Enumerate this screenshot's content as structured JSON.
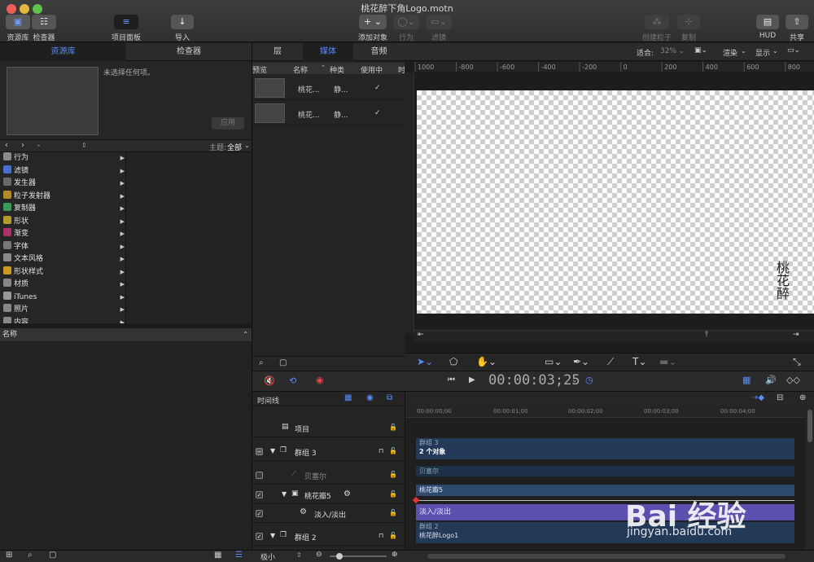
{
  "window": {
    "title": "桃花醉下角Logo.motn"
  },
  "toolbar": {
    "library": "资源库",
    "inspector": "检查器",
    "project_panel": "项目面板",
    "import": "导入",
    "add_object": "添加对象",
    "behaviors": "行为",
    "filters": "滤镜",
    "create_particles": "创建粒子",
    "replicate": "复制",
    "hud": "HUD",
    "share": "共享"
  },
  "left_panel": {
    "tabs": [
      "资源库",
      "检查器"
    ],
    "no_selection": "未选择任何项。",
    "apply": "应用",
    "path_value": "-",
    "theme_label": "主题:",
    "theme_value": "全部",
    "categories": [
      {
        "label": "行为",
        "icon": "gear-icon",
        "color": "#8a8a8a"
      },
      {
        "label": "滤镜",
        "icon": "filter-icon",
        "color": "#4a6fd1"
      },
      {
        "label": "发生器",
        "icon": "generator-icon",
        "color": "#6a6a6a"
      },
      {
        "label": "粒子发射器",
        "icon": "particle-icon",
        "color": "#b58a2a"
      },
      {
        "label": "复制器",
        "icon": "replicator-icon",
        "color": "#3a9a5a"
      },
      {
        "label": "形状",
        "icon": "shape-icon",
        "color": "#b59a2a"
      },
      {
        "label": "渐变",
        "icon": "gradient-icon",
        "color": "#b0306a"
      },
      {
        "label": "字体",
        "icon": "font-icon",
        "color": "#777777"
      },
      {
        "label": "文本风格",
        "icon": "text-style-icon",
        "color": "#8a8a8a"
      },
      {
        "label": "形状样式",
        "icon": "shape-style-icon",
        "color": "#c89a20"
      },
      {
        "label": "材质",
        "icon": "material-icon",
        "color": "#888888"
      },
      {
        "label": "iTunes",
        "icon": "itunes-icon",
        "color": "#999999"
      },
      {
        "label": "照片",
        "icon": "photos-icon",
        "color": "#888888"
      },
      {
        "label": "内容",
        "icon": "content-icon",
        "color": "#888888"
      }
    ],
    "name_header": "名称"
  },
  "middle_panel": {
    "tabs": [
      "层",
      "媒体",
      "音频"
    ],
    "columns": [
      "预览",
      "名称",
      "种类",
      "使用中",
      "时"
    ],
    "rows": [
      {
        "name": "桃花...",
        "kind": "静...",
        "in_use": "✓"
      },
      {
        "name": "桃花...",
        "kind": "静...",
        "in_use": "✓"
      }
    ]
  },
  "canvas": {
    "fit_label": "适合:",
    "zoom": "32%",
    "render": "渲染",
    "view": "显示",
    "ruler_ticks": [
      "1000",
      "-800",
      "-600",
      "-400",
      "-200",
      "0",
      "200",
      "400",
      "600",
      "800"
    ]
  },
  "transport": {
    "timecode": "00:00:03;25"
  },
  "timeline": {
    "title": "时间线",
    "ruler": [
      "00:00:00;00",
      "00:00:01;00",
      "00:00:02;00",
      "00:00:03;00",
      "00:00:04;00"
    ],
    "layers": [
      {
        "name": "项目",
        "checked": false
      },
      {
        "name": "群组 3",
        "checked": false
      },
      {
        "name": "贝塞尔",
        "checked": false
      },
      {
        "name": "桃花瓣5",
        "checked": true
      },
      {
        "name": "淡入/淡出",
        "checked": true
      },
      {
        "name": "群组 2",
        "checked": true
      }
    ],
    "bars": {
      "group3": "群组 3",
      "group3_sub": "2 个对象",
      "bezier": "贝塞尔",
      "petal": "桃花瓣5",
      "fade": "淡入/淡出",
      "group2": "群组 2",
      "group2_sub": "桃花醉Logo1"
    },
    "zoom_label": "极小"
  },
  "watermark": {
    "logo": "Bai 经验",
    "url": "jingyan.baidu.com"
  },
  "colors": {
    "accent": "#5a8cff",
    "fade_bar": "#5b4fb0",
    "track_bar": "#2d4a6e"
  }
}
